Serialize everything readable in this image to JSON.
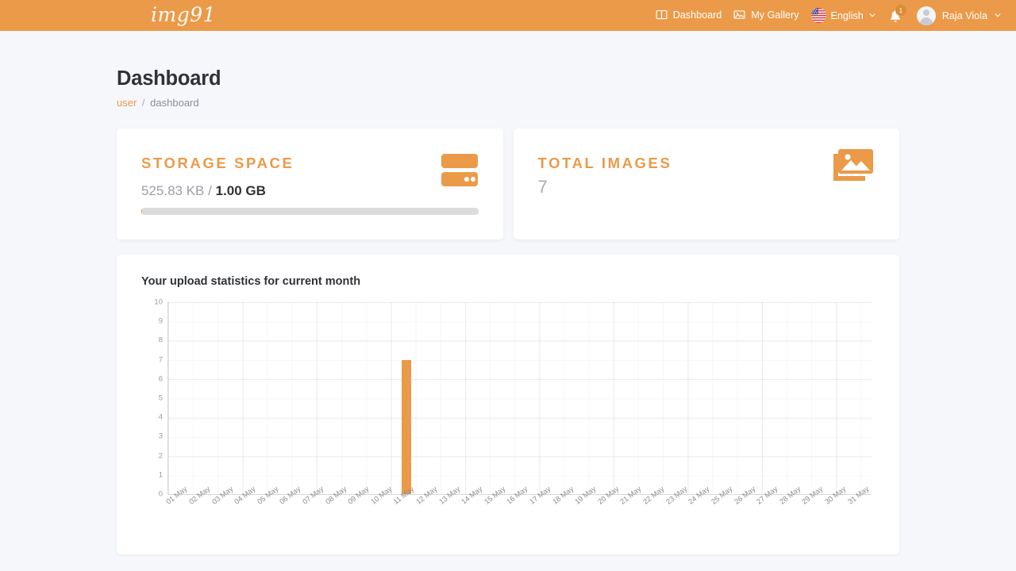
{
  "navbar": {
    "brand": "img91",
    "links": [
      {
        "label": "Dashboard",
        "icon": "columns-icon"
      },
      {
        "label": "My Gallery",
        "icon": "image-icon"
      }
    ],
    "language": {
      "label": "English",
      "flag": "us-flag-icon",
      "caret": "chevron-down-icon"
    },
    "notifications": {
      "icon": "bell-icon",
      "count": "1"
    },
    "user": {
      "name": "Raja Viola",
      "avatar": "avatar-icon",
      "caret": "chevron-down-icon"
    },
    "background_color": "#eb9a49"
  },
  "header": {
    "title": "Dashboard",
    "breadcrumb": {
      "root": "user",
      "separator": "/",
      "current": "dashboard"
    }
  },
  "stats": {
    "storage": {
      "title": "STORAGE SPACE",
      "used": "525.83 KB",
      "separator": "/",
      "total": "1.00 GB",
      "progress_percent": 0.05,
      "icon": "server-storage-icon"
    },
    "images": {
      "title": "TOTAL IMAGES",
      "value": "7",
      "icon": "photo-library-icon"
    }
  },
  "chart_panel": {
    "title": "Your upload statistics for current month"
  },
  "chart_data": {
    "type": "bar",
    "title": "Your upload statistics for current month",
    "xlabel": "",
    "ylabel": "",
    "ylim": [
      0,
      10
    ],
    "yticks": [
      0,
      1,
      2,
      3,
      4,
      5,
      6,
      7,
      8,
      9,
      10
    ],
    "grid": true,
    "legend": "none",
    "bar_color": "#eb9a49",
    "categories": [
      "01 May",
      "02 May",
      "03 May",
      "04 May",
      "05 May",
      "06 May",
      "07 May",
      "08 May",
      "09 May",
      "10 May",
      "11 May",
      "12 May",
      "13 May",
      "14 May",
      "15 May",
      "16 May",
      "17 May",
      "18 May",
      "19 May",
      "20 May",
      "21 May",
      "22 May",
      "23 May",
      "24 May",
      "25 May",
      "26 May",
      "27 May",
      "28 May",
      "29 May",
      "30 May",
      "31 May"
    ],
    "values": [
      0,
      0,
      0,
      0,
      0,
      0,
      0,
      0,
      0,
      0,
      7,
      0,
      0,
      0,
      0,
      0,
      0,
      0,
      0,
      0,
      0,
      0,
      0,
      0,
      0,
      0,
      0,
      0,
      0,
      0,
      0
    ]
  },
  "theme": {
    "accent": "#eb9a49",
    "page_background": "#f6f7fb",
    "card_background": "#ffffff",
    "text_dark": "#2f3237",
    "text_muted": "#9aa0a8"
  }
}
